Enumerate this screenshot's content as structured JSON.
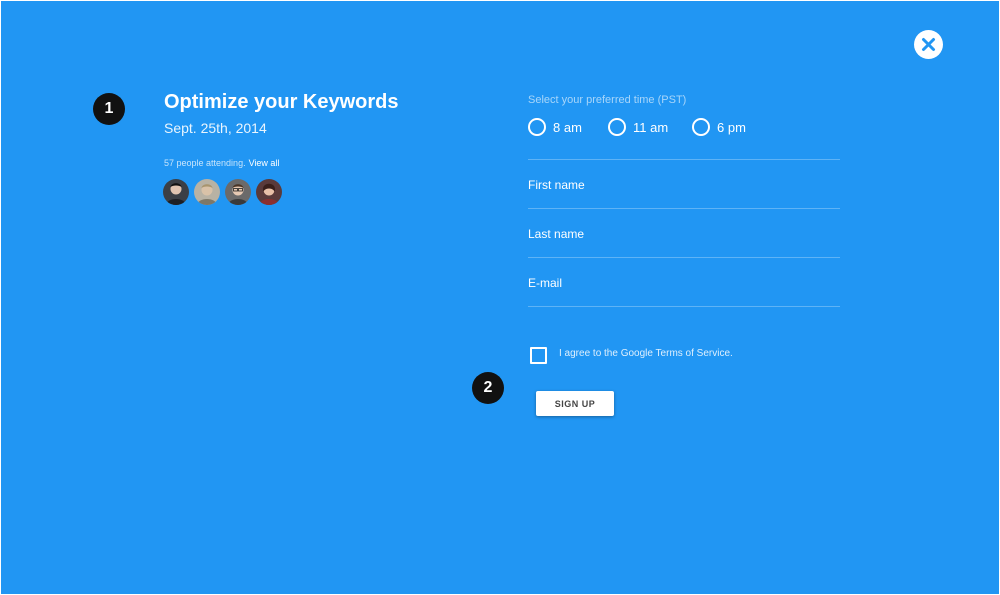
{
  "theme": {
    "background": "#2196f3",
    "text": "#ffffff",
    "marker": "#111111",
    "close_icon_color": "#2196f3"
  },
  "markers": [
    "1",
    "2"
  ],
  "event": {
    "title": "Optimize your Keywords",
    "date": "Sept. 25th, 2014",
    "attending_text": "57 people attending.",
    "view_all": "View all"
  },
  "attendees": [
    {
      "icon": "user-avatar-photo",
      "bg": "#3b3f45"
    },
    {
      "icon": "user-avatar-photo",
      "bg": "#b8b2a4"
    },
    {
      "icon": "user-avatar-photo",
      "bg": "#6b6a6a"
    },
    {
      "icon": "user-avatar-photo",
      "bg": "#5a3a3a"
    }
  ],
  "form": {
    "time_prompt": "Select your preferred time (PST)",
    "time_options": [
      "8 am",
      "11 am",
      "6 pm"
    ],
    "first_name_placeholder": "First name",
    "last_name_placeholder": "Last name",
    "email_placeholder": "E-mail",
    "terms_label": "I agree to the Google Terms of Service.",
    "signup_label": "SIGN UP"
  },
  "icons": {
    "close": "close-icon",
    "checkbox": "checkbox-icon",
    "radio": "radio-icon"
  }
}
